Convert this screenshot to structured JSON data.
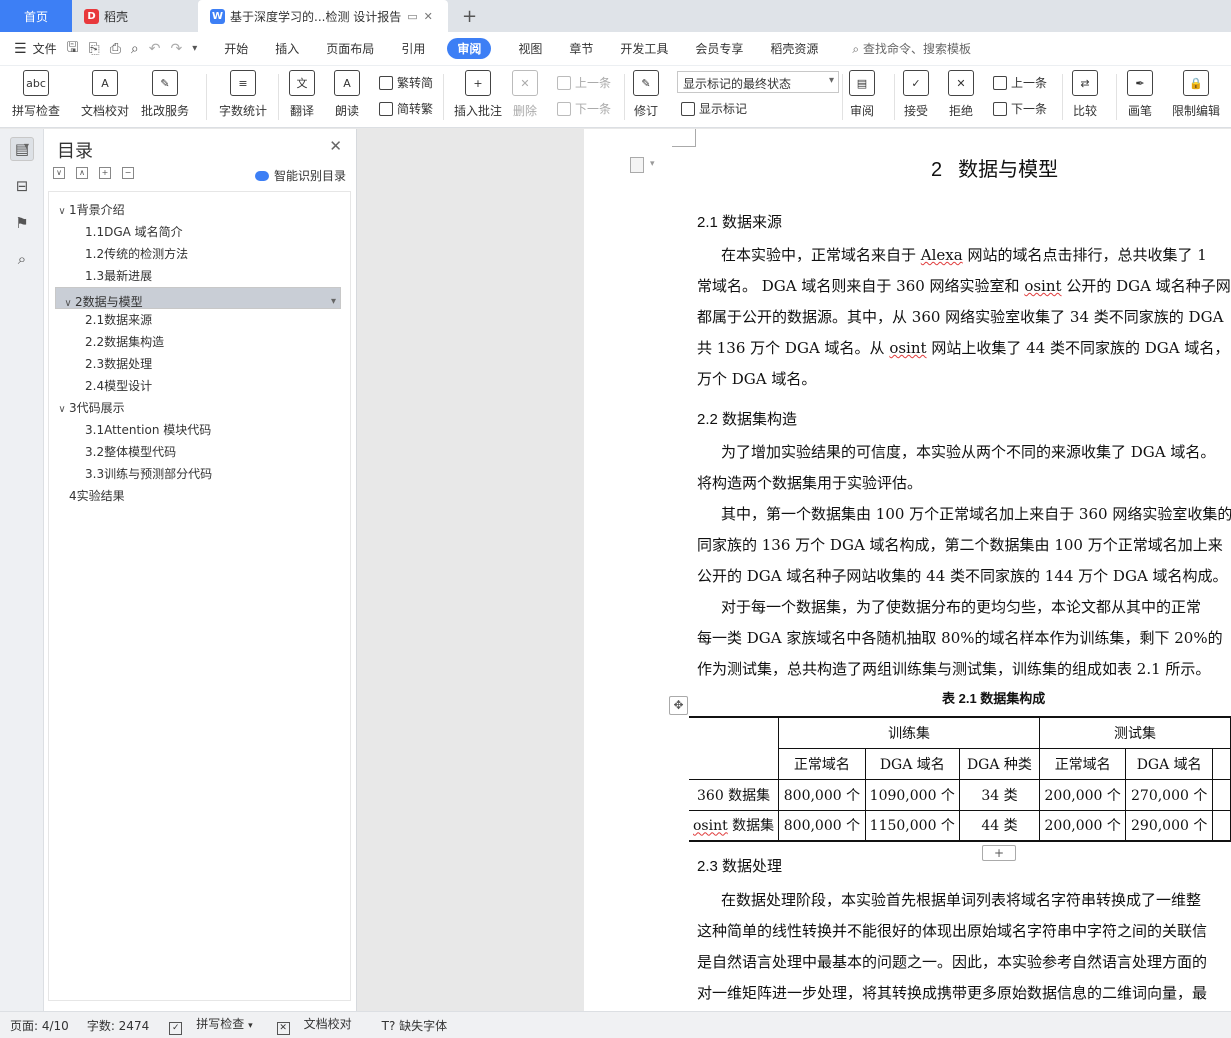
{
  "tabs": {
    "home": "首页",
    "daoke": "稻壳",
    "doc": "基于深度学习的...检测 设计报告",
    "add": "+"
  },
  "menu": {
    "file": "文件",
    "items": [
      "开始",
      "插入",
      "页面布局",
      "引用",
      "审阅",
      "视图",
      "章节",
      "开发工具",
      "会员专享",
      "稻壳资源"
    ],
    "active": "审阅",
    "search": "查找命令、搜索模板"
  },
  "ribbon": {
    "spell": "拼写检查",
    "doccheck": "文档校对",
    "batch": "批改服务",
    "wordcount": "字数统计",
    "translate": "翻译",
    "read": "朗读",
    "to_simp": "繁转简",
    "to_trad": "简转繁",
    "insert_comment": "插入批注",
    "delete": "删除",
    "prev": "上一条",
    "next": "下一条",
    "revise": "修订",
    "markup_select": "显示标记的最终状态",
    "show_markup": "显示标记",
    "review": "审阅",
    "accept": "接受",
    "reject": "拒绝",
    "prev2": "上一条",
    "next2": "下一条",
    "compare": "比较",
    "pen": "画笔",
    "restrict": "限制编辑"
  },
  "toc": {
    "title": "目录",
    "smart": "智能识别目录",
    "items": [
      {
        "label": "1背景介绍",
        "level": 1
      },
      {
        "label": "1.1DGA 域名简介",
        "level": 2
      },
      {
        "label": "1.2传统的检测方法",
        "level": 2
      },
      {
        "label": "1.3最新进展",
        "level": 2
      },
      {
        "label": "2数据与模型",
        "level": 1
      },
      {
        "label": "2.1数据来源",
        "level": 2
      },
      {
        "label": "2.2数据集构造",
        "level": 2
      },
      {
        "label": "2.3数据处理",
        "level": 2
      },
      {
        "label": "2.4模型设计",
        "level": 2
      },
      {
        "label": "3代码展示",
        "level": 1
      },
      {
        "label": "3.1Attention 模块代码",
        "level": 2
      },
      {
        "label": "3.2整体模型代码",
        "level": 2
      },
      {
        "label": "3.3训练与预测部分代码",
        "level": 2
      },
      {
        "label": "4实验结果",
        "level": 1
      }
    ]
  },
  "doc": {
    "chapter_num": "2",
    "chapter_title": "数据与模型",
    "s21": "2.1  数据来源",
    "p1a_pre": "在本实验中，正常域名来自于 ",
    "p1a_alexa": "Alexa",
    "p1a_post": " 网站的域名点击排行，总共收集了 1",
    "p1b": "常域名。 DGA 域名则来自于 360 网络实验室和 ",
    "p1b_osint": "osint",
    "p1b_post": " 公开的 DGA 域名种子网",
    "p1c": "都属于公开的数据源。其中，从 360 网络实验室收集了 34 类不同家族的 DGA",
    "p1d_pre": "共 136 万个 DGA 域名。从 ",
    "p1d_osint": "osint",
    "p1d_post": " 网站上收集了 44 类不同家族的 DGA 域名，",
    "p1e": "万个 DGA 域名。",
    "s22": "2.2  数据集构造",
    "p2a": "为了增加实验结果的可信度，本实验从两个不同的来源收集了 DGA 域名。",
    "p2b": "将构造两个数据集用于实验评估。",
    "p3a": "其中，第一个数据集由 100 万个正常域名加上来自于 360 网络实验室收集的",
    "p3b": "同家族的 136 万个 DGA 域名构成，第二个数据集由 100 万个正常域名加上来",
    "p3c": "公开的 DGA 域名种子网站收集的 44 类不同家族的 144 万个 DGA 域名构成。",
    "p4a": "对于每一个数据集，为了使数据分布的更均匀些，本论文都从其中的正常",
    "p4b": "每一类 DGA 家族域名中各随机抽取 80%的域名样本作为训练集，剩下 20%的",
    "p4c": "作为测试集，总共构造了两组训练集与测试集，训练集的组成如表 2.1 所示。",
    "table_caption": "表 2.1  数据集构成",
    "table": {
      "group_train": "训练集",
      "group_test": "测试集",
      "headers": [
        "正常域名",
        "DGA 域名",
        "DGA 种类",
        "正常域名",
        "DGA 域名"
      ],
      "rows": [
        {
          "name": "360 数据集",
          "cells": [
            "800,000 个",
            "1090,000 个",
            "34 类",
            "200,000 个",
            "270,000 个"
          ]
        },
        {
          "name_pre": "",
          "name_osint": "osint",
          "name_post": " 数据集",
          "cells": [
            "800,000 个",
            "1150,000 个",
            "44 类",
            "200,000 个",
            "290,000 个"
          ]
        }
      ]
    },
    "s23": "2.3  数据处理",
    "p5a": "在数据处理阶段，本实验首先根据单词列表将域名字符串转换成了一维整",
    "p5b": "这种简单的线性转换并不能很好的体现出原始域名字符串中字符之间的关联信",
    "p5c": "是自然语言处理中最基本的问题之一。因此，本实验参考自然语言处理方面的",
    "p5d": "对一维矩阵进一步处理，将其转换成携带更多原始数据信息的二维词向量，最"
  },
  "status": {
    "page": "页面: 4/10",
    "words": "字数: 2474",
    "spell": "拼写检查",
    "doccheck": "文档校对",
    "missing_font": "缺失字体"
  }
}
